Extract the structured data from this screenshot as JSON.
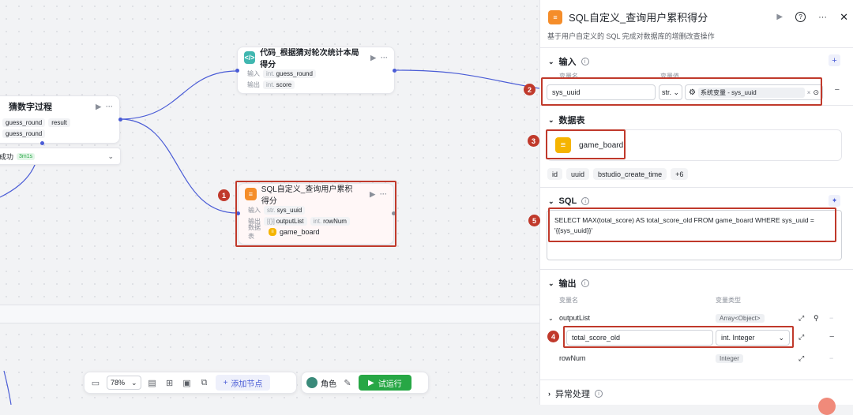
{
  "colors": {
    "accent": "#4a5cd6",
    "run_green": "#27a745",
    "annotation_red": "#c0392b",
    "sql_orange": "#f58d2a",
    "db_yellow": "#f5b400",
    "code_teal": "#40b7b0"
  },
  "nodes": {
    "guess_process": {
      "title": "猜数字过程",
      "rows": [
        {
          "tag": "guess_round",
          "tag2": "result"
        },
        {
          "tag": "guess_round"
        }
      ],
      "status_text": "成功",
      "status_badge": "3m1s"
    },
    "code_node": {
      "title": "代码_根据猜对轮次统计本局得分",
      "input_label": "输入",
      "input_type": "int.",
      "input_value": "guess_round",
      "output_label": "输出",
      "output_type": "int.",
      "output_value": "score"
    },
    "sql_node": {
      "title": "SQL自定义_查询用户累积得分",
      "input_label": "输入",
      "input_type": "str.",
      "input_value": "sys_uuid",
      "output_label": "输出",
      "output_type1": "[{}]",
      "output_value1": "outputList",
      "output_type2": "int.",
      "output_value2": "rowNum",
      "table_label": "数据表",
      "table_value": "game_board"
    }
  },
  "toolbar": {
    "zoom": "78%",
    "add_node": "添加节点",
    "role": "角色",
    "run": "试运行"
  },
  "panel": {
    "title": "SQL自定义_查询用户累积得分",
    "description": "基于用户自定义的 SQL 完成对数据库的增删改查操作",
    "input_section": {
      "title": "输入",
      "col_name": "变量名",
      "col_value": "变量值",
      "var_name": "sys_uuid",
      "var_type": "str.",
      "var_value": "系统变量 - sys_uuid"
    },
    "table_section": {
      "title": "数据表",
      "table_name": "game_board",
      "fields": [
        "id",
        "uuid",
        "bstudio_create_time",
        "+6"
      ]
    },
    "sql_section": {
      "title": "SQL",
      "query": "SELECT MAX(total_score) AS total_score_old FROM game_board WHERE sys_uuid = '{{sys_uuid}}'"
    },
    "output_section": {
      "title": "输出",
      "col_name": "变量名",
      "col_type": "变量类型",
      "rows": [
        {
          "name": "outputList",
          "type": "Array<Object>"
        },
        {
          "name": "total_score_old",
          "type": "int. Integer"
        },
        {
          "name": "rowNum",
          "type": "Integer"
        }
      ]
    },
    "error_section": {
      "title": "异常处理"
    }
  },
  "annotations": [
    "1",
    "2",
    "3",
    "4",
    "5"
  ]
}
